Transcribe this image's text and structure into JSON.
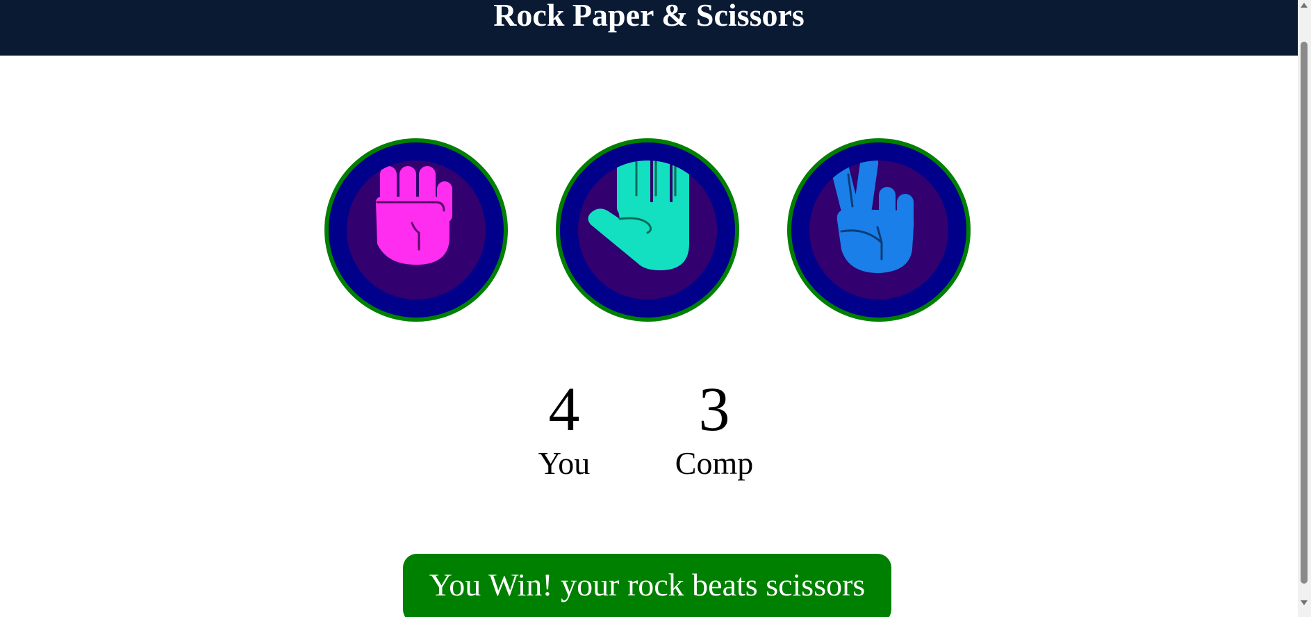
{
  "header": {
    "title": "Rock Paper & Scissors",
    "background": "#0a1a33"
  },
  "choices": [
    {
      "id": "rock",
      "icon": "rock-fist-icon",
      "color": "#ff2df0"
    },
    {
      "id": "paper",
      "icon": "paper-hand-icon",
      "color": "#13e0c0"
    },
    {
      "id": "scissors",
      "icon": "scissors-victory-hand-icon",
      "color": "#1a7fe8"
    }
  ],
  "choice_style": {
    "ring_color": "#008000",
    "outer_color": "#00008b",
    "inner_color": "#32006f"
  },
  "scores": {
    "user": {
      "value": "4",
      "label": "You"
    },
    "comp": {
      "value": "3",
      "label": "Comp"
    }
  },
  "result": {
    "message": "You Win! your rock beats scissors",
    "color": "#008000"
  }
}
